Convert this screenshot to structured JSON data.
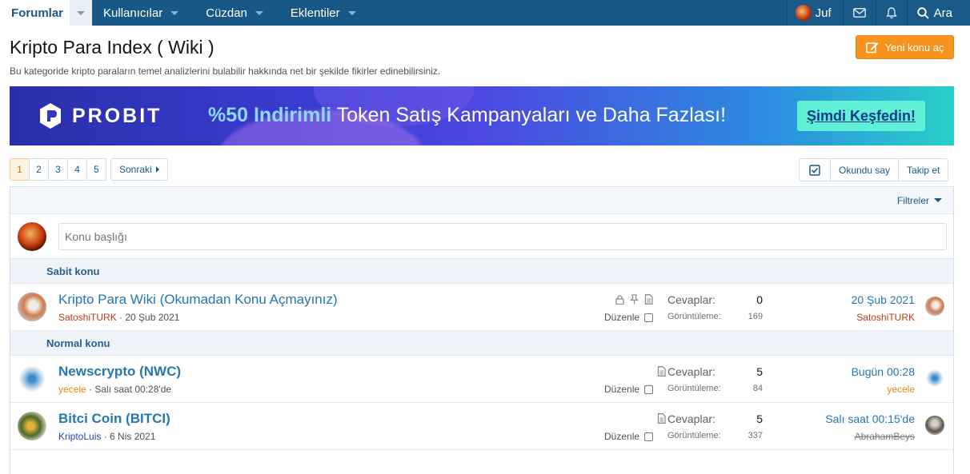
{
  "nav": {
    "tabs": [
      {
        "label": "Forumlar",
        "active": true
      },
      {
        "label": "Kullanıcılar"
      },
      {
        "label": "Cüzdan"
      },
      {
        "label": "Eklentiler"
      }
    ],
    "user": "Juf",
    "search": "Ara"
  },
  "page": {
    "title": "Kripto Para Index ( Wiki )",
    "description": "Bu kategoride kripto paraların temel analizlerini bulabilir hakkında net bir şekilde fikirler edinebilirsiniz.",
    "new_thread": "Yeni konu aç"
  },
  "banner": {
    "brand": "PROBIT",
    "highlight": "%50 Indirimli",
    "headline": " Token Satış Kampanyaları ve Daha Fazlası!",
    "cta": "Şimdi Keşfedin!"
  },
  "pagination": {
    "pages": [
      "1",
      "2",
      "3",
      "4",
      "5"
    ],
    "current": "1",
    "next": "Sonraki"
  },
  "tools": {
    "mark_read": "Okundu say",
    "follow": "Takip et"
  },
  "filters": "Filtreler",
  "quick_thread": {
    "placeholder": "Konu başlığı"
  },
  "sections": {
    "sticky": "Sabit konu",
    "normal": "Normal konu"
  },
  "labels": {
    "replies": "Cevaplar:",
    "views": "Görüntüleme:",
    "edit": "Düzenle"
  },
  "threads": [
    {
      "title": "Kripto Para Wiki (Okumadan Konu Açmayınız)",
      "author": "SatoshiTURK",
      "date": " · 20 Şub 2021",
      "replies": "0",
      "views": "169",
      "last_date": "20 Şub 2021",
      "last_user": "SatoshiTURK"
    },
    {
      "title": "Newscrypto (NWC)",
      "author": "yecele",
      "date": " · Salı saat 00:28'de",
      "replies": "5",
      "views": "84",
      "last_date": "Bugün 00:28",
      "last_user": "yecele"
    },
    {
      "title": "Bitci Coin (BITCI)",
      "author": "KriptoLuis",
      "date": " · 6 Nis 2021",
      "replies": "5",
      "views": "337",
      "last_date": "Salı saat 00:15'de",
      "last_user": "AbrahamBeys"
    }
  ],
  "colors": {
    "nav": "#185886",
    "accent_button": "#f7941d",
    "link": "#2577b1"
  }
}
